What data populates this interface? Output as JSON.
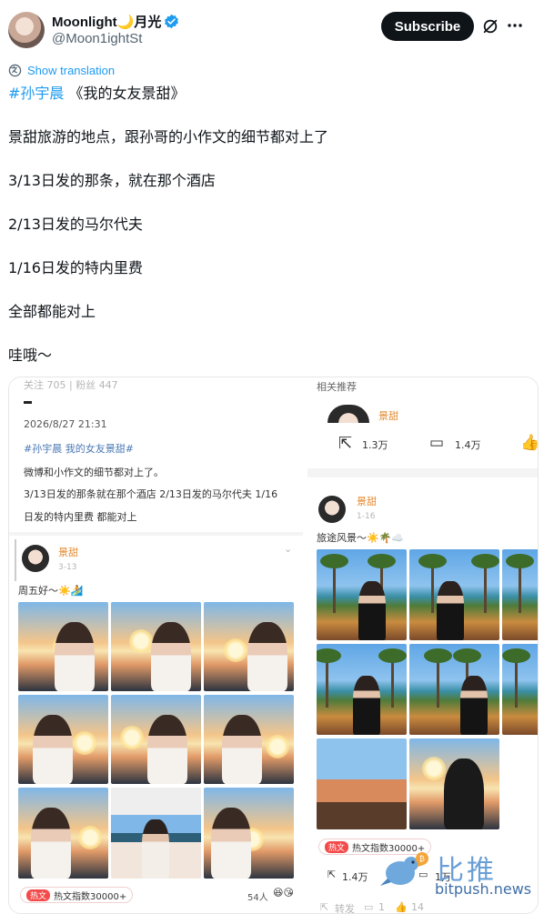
{
  "tweet": {
    "author": {
      "display_name": "Moonlight🌙月光",
      "handle": "@Moon1ightSt",
      "verified": true
    },
    "subscribe_label": "Subscribe",
    "show_translation": "Show translation",
    "hashtag": "#孙宇晨",
    "title": "《我的女友景甜》",
    "lines": [
      "景甜旅游的地点，跟孙哥的小作文的细节都对上了",
      "3/13日发的那条，就在那个酒店",
      "2/13日发的马尔代夫",
      "1/16日发的特内里费",
      "全部都能对上",
      "哇哦～"
    ]
  },
  "left_screenshot": {
    "top_meta": "关注 705 | 粉丝 447",
    "post_date": "2026/8/27 21:31",
    "hashtags": "#孙宇晨 我的女友景甜#",
    "body_1": "微博和小作文的细节都对上了。",
    "body_2": "3/13日发的那条就在那个酒店 2/13日发的马尔代夫 1/16",
    "body_3": "日发的特内里费 都能对上",
    "repost_user": "景甜",
    "repost_date": "3-13",
    "repost_caption": "周五好～☀️🏄",
    "badge_tag": "热文",
    "badge_text": "热文指数30000+",
    "likes": "54人"
  },
  "right_screenshot": {
    "header": "相关推荐",
    "top_user": "景甜",
    "share_count": "1.3万",
    "comment_count": "1.4万",
    "user": "景甜",
    "date": "1-16",
    "caption": "旅途风景～☀️🌴☁️",
    "badge_tag": "热文",
    "badge_text": "热文指数30000+",
    "stat_1": "1.4万",
    "stat_2": "1万",
    "bottom_repost": "转发",
    "bottom_comment": "1",
    "bottom_like": "14"
  },
  "watermark": {
    "cn": "比推",
    "en": "bitpush.news"
  },
  "colors": {
    "link": "#1d9bf0",
    "text": "#0f1419",
    "muted": "#536471",
    "subscribe_bg": "#0f1419"
  }
}
